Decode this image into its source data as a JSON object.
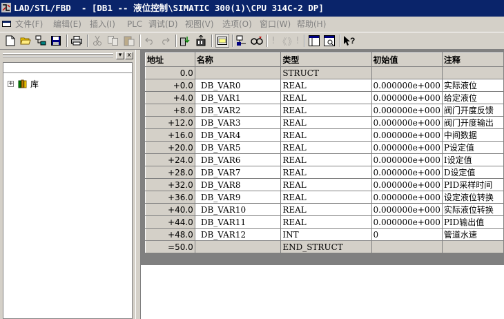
{
  "titlebar": {
    "title": "LAD/STL/FBD  - [DB1 -- 液位控制\\SIMATIC 300(1)\\CPU 314C-2 DP]"
  },
  "menubar": {
    "items": [
      {
        "label": "文件(F)"
      },
      {
        "label": "编辑(E)"
      },
      {
        "label": "插入(I)"
      },
      {
        "label": "PLC"
      },
      {
        "label": "调试(D)"
      },
      {
        "label": "视图(V)"
      },
      {
        "label": "选项(O)"
      },
      {
        "label": "窗口(W)"
      },
      {
        "label": "帮助(H)"
      }
    ]
  },
  "toolbar": {
    "buttons": [
      {
        "icon": "new-file-icon"
      },
      {
        "icon": "open-folder-icon"
      },
      {
        "icon": "accessible-nodes-icon"
      },
      {
        "icon": "save-icon"
      },
      {
        "icon": "print-icon"
      },
      {
        "icon": "cut-icon"
      },
      {
        "icon": "copy-icon"
      },
      {
        "icon": "paste-icon"
      },
      {
        "icon": "undo-icon"
      },
      {
        "icon": "redo-icon"
      },
      {
        "icon": "download-icon"
      },
      {
        "icon": "upload-icon"
      },
      {
        "icon": "overview-icon"
      },
      {
        "icon": "network-icon"
      },
      {
        "icon": "monitor-icon"
      },
      {
        "icon": "bookmark-icon"
      },
      {
        "icon": "prev-icon"
      },
      {
        "icon": "next-icon"
      },
      {
        "icon": "window-split-icon"
      },
      {
        "icon": "details-icon"
      },
      {
        "icon": "help-icon"
      }
    ],
    "text_glyphs": {
      "bang": "!",
      "prev": "《",
      "next": "》",
      "bang2": "!"
    }
  },
  "leftpanel": {
    "tree": {
      "root_label": "库",
      "expander": "+"
    },
    "buttons": {
      "menu": "▾",
      "close": "x"
    }
  },
  "table": {
    "headers": [
      "地址",
      "名称",
      "类型",
      "初始值",
      "注释"
    ],
    "rows": [
      {
        "addr": "0.0",
        "name": "",
        "type": "STRUCT",
        "init": "",
        "comment": "",
        "gray": true
      },
      {
        "addr": "+0.0",
        "name": "DB_VAR0",
        "type": "REAL",
        "init": "0.000000e+000",
        "comment": "实际液位"
      },
      {
        "addr": "+4.0",
        "name": "DB_VAR1",
        "type": "REAL",
        "init": "0.000000e+000",
        "comment": "给定液位"
      },
      {
        "addr": "+8.0",
        "name": "DB_VAR2",
        "type": "REAL",
        "init": "0.000000e+000",
        "comment": "阀门开度反馈"
      },
      {
        "addr": "+12.0",
        "name": "DB_VAR3",
        "type": "REAL",
        "init": "0.000000e+000",
        "comment": "阀门开度输出"
      },
      {
        "addr": "+16.0",
        "name": "DB_VAR4",
        "type": "REAL",
        "init": "0.000000e+000",
        "comment": "中间数据"
      },
      {
        "addr": "+20.0",
        "name": "DB_VAR5",
        "type": "REAL",
        "init": "0.000000e+000",
        "comment": "P设定值"
      },
      {
        "addr": "+24.0",
        "name": "DB_VAR6",
        "type": "REAL",
        "init": "0.000000e+000",
        "comment": "I设定值"
      },
      {
        "addr": "+28.0",
        "name": "DB_VAR7",
        "type": "REAL",
        "init": "0.000000e+000",
        "comment": "D设定值"
      },
      {
        "addr": "+32.0",
        "name": "DB_VAR8",
        "type": "REAL",
        "init": "0.000000e+000",
        "comment": "PID采样时间"
      },
      {
        "addr": "+36.0",
        "name": "DB_VAR9",
        "type": "REAL",
        "init": "0.000000e+000",
        "comment": "设定液位转换"
      },
      {
        "addr": "+40.0",
        "name": "DB_VAR10",
        "type": "REAL",
        "init": "0.000000e+000",
        "comment": "实际液位转换"
      },
      {
        "addr": "+44.0",
        "name": "DB_VAR11",
        "type": "REAL",
        "init": "0.000000e+000",
        "comment": "PID输出值"
      },
      {
        "addr": "+48.0",
        "name": "DB_VAR12",
        "type": "INT",
        "init": "0",
        "comment": "管道水速"
      },
      {
        "addr": "=50.0",
        "name": "",
        "type": "END_STRUCT",
        "init": "",
        "comment": "",
        "gray": true
      }
    ]
  },
  "colors": {
    "titlebar_bg": "#0a246a",
    "window_bg": "#d4d0c8",
    "grid_bg": "#808080"
  }
}
